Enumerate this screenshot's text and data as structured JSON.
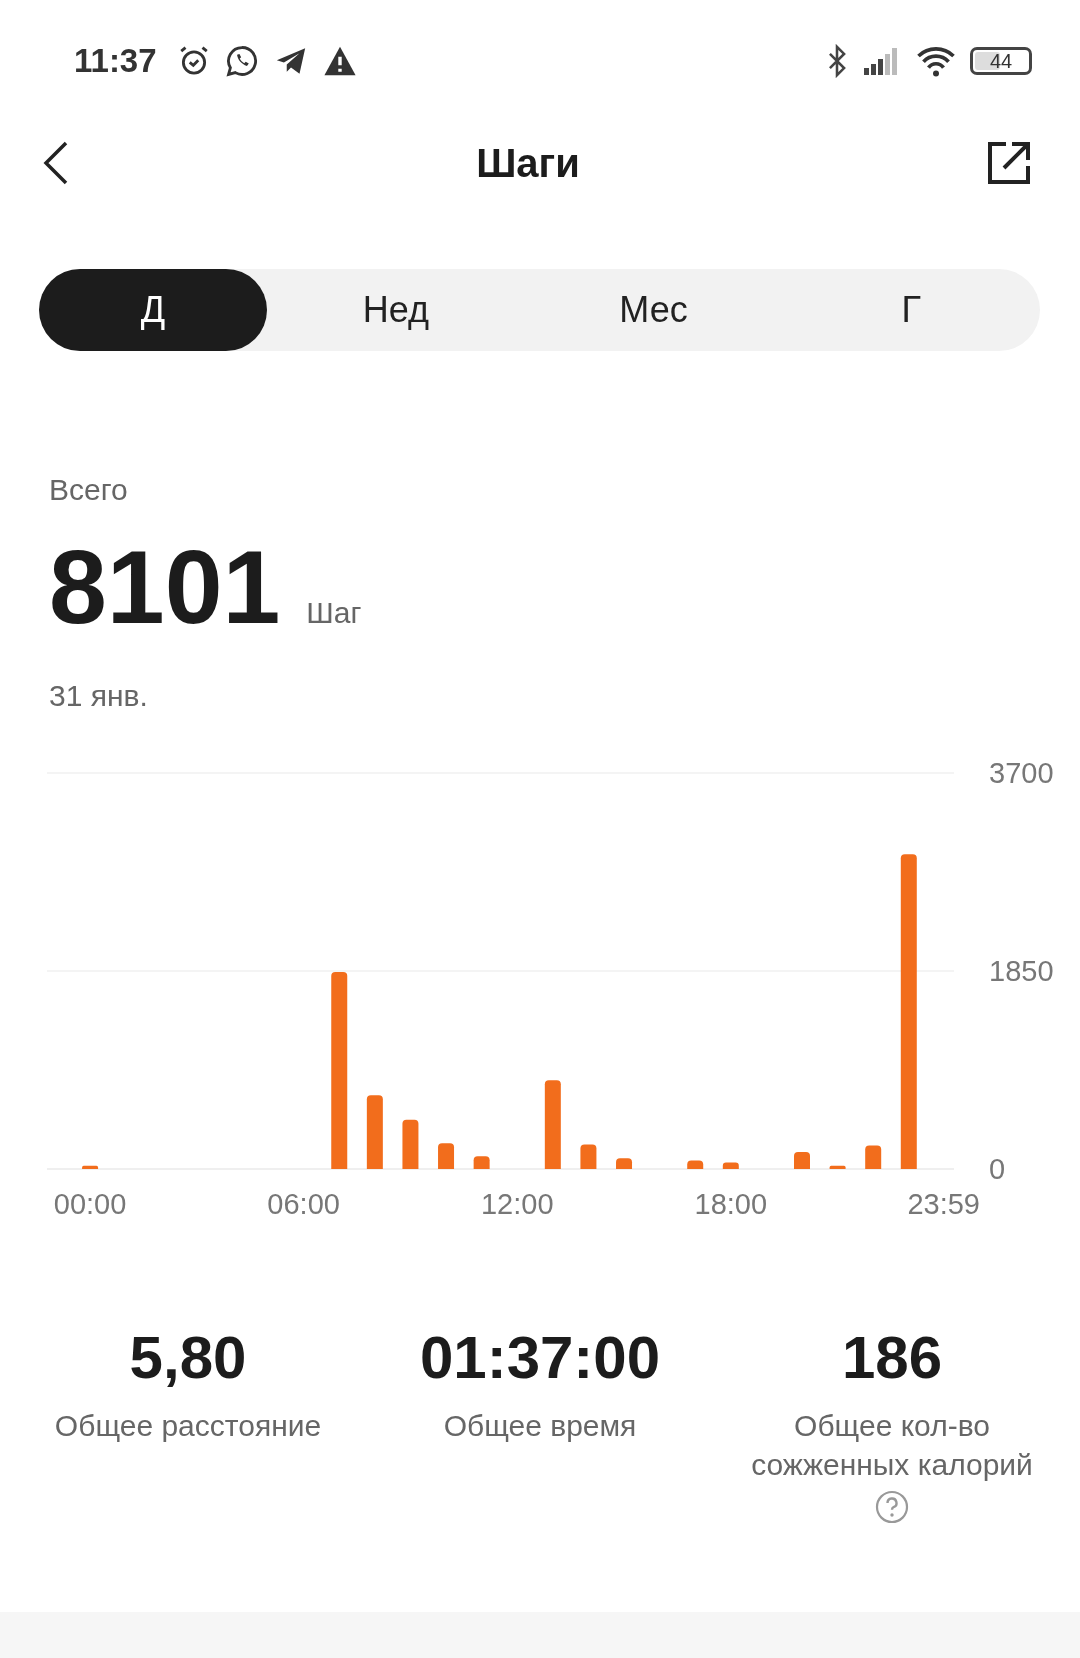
{
  "status_bar": {
    "time": "11:37",
    "battery": "44"
  },
  "header": {
    "title": "Шаги"
  },
  "tabs": [
    {
      "label": "Д",
      "selected": true
    },
    {
      "label": "Нед",
      "selected": false
    },
    {
      "label": "Мес",
      "selected": false
    },
    {
      "label": "Г",
      "selected": false
    }
  ],
  "summary": {
    "label": "Всего",
    "value": "8101",
    "unit": "Шаг",
    "date": "31 янв."
  },
  "chart": {
    "chart_data": {
      "type": "bar",
      "x": [
        0,
        1,
        2,
        3,
        4,
        5,
        6,
        7,
        8,
        9,
        10,
        11,
        12,
        13,
        14,
        15,
        16,
        17,
        18,
        19,
        20,
        21,
        22,
        23
      ],
      "series": [
        {
          "color": "#f26d1c",
          "values": [
            30,
            0,
            0,
            0,
            0,
            0,
            0,
            1840,
            690,
            460,
            240,
            120,
            0,
            830,
            230,
            100,
            0,
            80,
            60,
            0,
            160,
            30,
            220,
            2940
          ]
        }
      ],
      "xlim": [
        -1.21,
        24.27
      ],
      "ylim": [
        0,
        3700
      ],
      "yticks": [
        0,
        1850,
        3700
      ],
      "xticks": [
        {
          "value": 0,
          "label": "00:00"
        },
        {
          "value": 6,
          "label": "06:00"
        },
        {
          "value": 12,
          "label": "12:00"
        },
        {
          "value": 18,
          "label": "18:00"
        },
        {
          "value": 23.98,
          "label": "23:59"
        }
      ]
    }
  },
  "stats": [
    {
      "value": "5,80",
      "label": "Общее расстояние",
      "help": false
    },
    {
      "value": "01:37:00",
      "label": "Общее время",
      "help": false
    },
    {
      "value": "186",
      "label": "Общее кол-во сожженных калорий",
      "help": true
    }
  ]
}
